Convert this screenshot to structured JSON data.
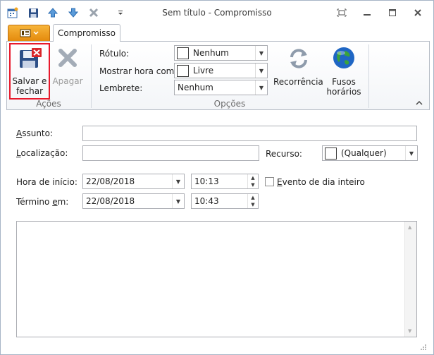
{
  "window": {
    "title": "Sem título - Compromisso"
  },
  "tabs": {
    "active": "Compromisso"
  },
  "ribbon": {
    "acoes": {
      "group_label": "Ações",
      "save_close_line1": "Salvar e",
      "save_close_line2": "fechar",
      "delete_label": "Apagar"
    },
    "opcoes": {
      "group_label": "Opções",
      "rotulo_label": "Rótulo:",
      "rotulo_value": "Nenhum",
      "mostrar_label": "Mostrar hora como:",
      "mostrar_value": "Livre",
      "lembrete_label": "Lembrete:",
      "lembrete_value": "Nenhum",
      "recorrencia_label": "Recorrência",
      "fusos_line1": "Fusos",
      "fusos_line2": "horários"
    }
  },
  "form": {
    "assunto_label": "Assunto:",
    "assunto_value": "",
    "localizacao_label": "Localização:",
    "localizacao_value": "",
    "recurso_label": "Recurso:",
    "recurso_value": "(Qualquer)",
    "inicio_label": "Hora de início:",
    "inicio_date": "22/08/2018",
    "inicio_time": "10:13",
    "dia_inteiro_label": "Evento de dia inteiro",
    "dia_inteiro_checked": false,
    "termino_label": "Término em:",
    "termino_date": "22/08/2018",
    "termino_time": "10:43",
    "notes": ""
  },
  "colors": {
    "highlight": "#e8192c",
    "file_tab": "#e8900f",
    "border": "#abadb3"
  }
}
